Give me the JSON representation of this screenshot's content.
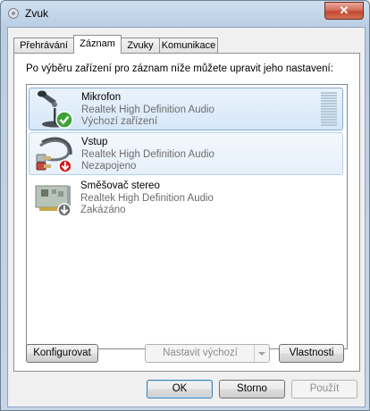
{
  "window": {
    "title": "Zvuk",
    "close_label": "✕"
  },
  "tabs": [
    {
      "label": "Přehrávání",
      "active": false
    },
    {
      "label": "Záznam",
      "active": true
    },
    {
      "label": "Zvuky",
      "active": false
    },
    {
      "label": "Komunikace",
      "active": false
    }
  ],
  "panel": {
    "instruction": "Po výběru zařízení pro záznam níže můžete upravit jeho nastavení:"
  },
  "devices": [
    {
      "name": "Mikrofon",
      "driver": "Realtek High Definition Audio",
      "status": "Výchozí zařízení",
      "icon": "microphone-icon",
      "badge": "green-check"
    },
    {
      "name": "Vstup",
      "driver": "Realtek High Definition Audio",
      "status": "Nezapojeno",
      "icon": "rca-cable-icon",
      "badge": "red-down-arrow"
    },
    {
      "name": "Směšovač stereo",
      "driver": "Realtek High Definition Audio",
      "status": "Zakázáno",
      "icon": "sound-card-icon",
      "badge": "gray-down-arrow"
    }
  ],
  "buttons": {
    "configure": "Konfigurovat",
    "set_default": "Nastavit výchozí",
    "properties": "Vlastnosti",
    "ok": "OK",
    "cancel": "Storno",
    "apply": "Použít"
  },
  "colors": {
    "selection": "#d6e7f8",
    "selection_border": "#84acdd",
    "check_green": "#3aa336",
    "arrow_red": "#d21f1f"
  }
}
